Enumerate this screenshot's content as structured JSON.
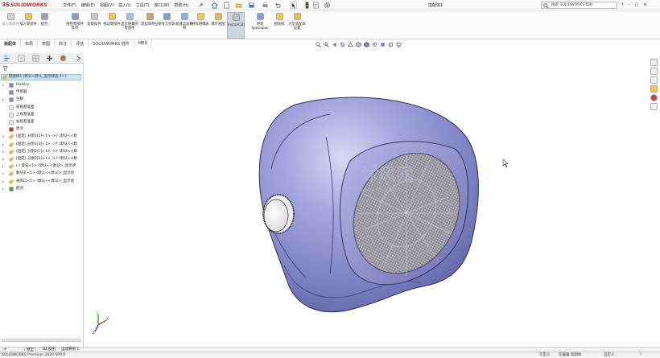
{
  "app": {
    "logo_text": "SOLIDWORKS",
    "doc_title": "搅配体1",
    "menus": [
      "文件(F)",
      "编辑(E)",
      "视图(V)",
      "插入(I)",
      "工具(T)",
      "窗口(W)",
      "帮助(H)"
    ],
    "search_placeholder": "搜索 SOLIDWORKS 帮助",
    "title_controls": [
      "?",
      "-",
      "□",
      "×"
    ]
  },
  "ribbon": [
    {
      "label": "插入零部件",
      "style": "gray"
    },
    {
      "label": "插入零部件",
      "style": "normal"
    },
    {
      "label": "配合",
      "style": "normal"
    },
    {
      "label": "线性零部件阵列",
      "style": "normal"
    },
    {
      "label": "智能扣件",
      "style": "normal"
    },
    {
      "label": "移动零部件",
      "style": "normal"
    },
    {
      "label": "显示隐藏的零部件",
      "style": "normal"
    },
    {
      "label": "装配体特征",
      "style": "normal"
    },
    {
      "label": "参考几何体",
      "style": "normal"
    },
    {
      "label": "新建运动算例",
      "style": "normal"
    },
    {
      "label": "材料明细表",
      "style": "normal"
    },
    {
      "label": "爆炸视图",
      "style": "normal"
    },
    {
      "label": "Instant3D",
      "style": "active"
    },
    {
      "label": "更新Speedpak",
      "style": "normal"
    },
    {
      "label": "拍快照",
      "style": "normal"
    },
    {
      "label": "大型装配体设置",
      "style": "normal"
    }
  ],
  "tabs": [
    "装配体",
    "布局",
    "草图",
    "标注",
    "评估",
    "SOLIDWORKS 插件",
    "MBD"
  ],
  "tree": {
    "root": "搅配体1 (默认<默认_显示状态-1>)",
    "items": [
      {
        "label": "History",
        "expand": "▸"
      },
      {
        "label": "传感器",
        "expand": ""
      },
      {
        "label": "注解",
        "expand": "▸"
      },
      {
        "label": "前视基准面",
        "expand": ""
      },
      {
        "label": "上视基准面",
        "expand": ""
      },
      {
        "label": "右视基准面",
        "expand": ""
      },
      {
        "label": "原点",
        "expand": ""
      },
      {
        "label": "(固定) 分割1[1]<1> ->? (默认<<默",
        "expand": "▸"
      },
      {
        "label": "(固定) 分割1[3]<1> ->? (默认<<默",
        "expand": "▸"
      },
      {
        "label": "(固定) 分割2[1]<1> ->? (默认<<默",
        "expand": "▸"
      },
      {
        "label": "(固定) 分割2[2]<1> ->? (默认<<默",
        "expand": "▸"
      },
      {
        "label": "(-) 旋钮<1> (默认<<默认>_显示状",
        "expand": "▸"
      },
      {
        "label": "散热孔<1> (默认<<默认>_显示状",
        "expand": "▸"
      },
      {
        "label": "通风口<1> (默认<<默认>_显示状",
        "expand": "▸"
      },
      {
        "label": "配合",
        "expand": "▸"
      }
    ]
  },
  "bottom_tabs": [
    "模型",
    "3D 视图",
    "运动算例 1"
  ],
  "status": {
    "product": "SOLIDWORKS Premium 2020 SP0.0",
    "undefined": "欠定义",
    "editing": "在编辑 装配体",
    "custom": "自定义"
  },
  "watermark": {
    "cn": "沐风网",
    "url": "www.mfcad.com"
  },
  "colors": {
    "accent": "#d8262c",
    "shell": "#8a8dcc",
    "shell_light": "#c9cbee",
    "grille": "#a2a0a8",
    "selected_row": "#cde3f7"
  }
}
